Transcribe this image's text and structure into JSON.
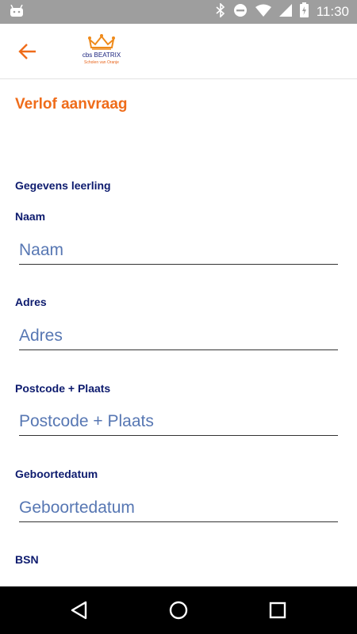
{
  "status_bar": {
    "time": "11:30",
    "icons": [
      "android-icon",
      "bluetooth-icon",
      "do-not-disturb-icon",
      "wifi-icon",
      "signal-icon",
      "battery-charging-icon"
    ]
  },
  "app_bar": {
    "back_icon": "arrow-left-icon",
    "logo": {
      "name": "cbs BEATRIX",
      "tagline": "Scholen van Oranje"
    }
  },
  "page": {
    "title": "Verlof aanvraag",
    "section_title": "Gegevens leerling",
    "fields": [
      {
        "label": "Naam",
        "placeholder": "Naam",
        "value": ""
      },
      {
        "label": "Adres",
        "placeholder": "Adres",
        "value": ""
      },
      {
        "label": "Postcode + Plaats",
        "placeholder": "Postcode + Plaats",
        "value": ""
      },
      {
        "label": "Geboortedatum",
        "placeholder": "Geboortedatum",
        "value": ""
      },
      {
        "label": "BSN"
      }
    ]
  },
  "nav_bar": {
    "icons": [
      "back-triangle-icon",
      "home-circle-icon",
      "recents-square-icon"
    ]
  },
  "colors": {
    "accent": "#ef6c1a",
    "label": "#0d1b6e",
    "placeholder": "#5777b3",
    "status_bar": "#9e9e9e"
  }
}
